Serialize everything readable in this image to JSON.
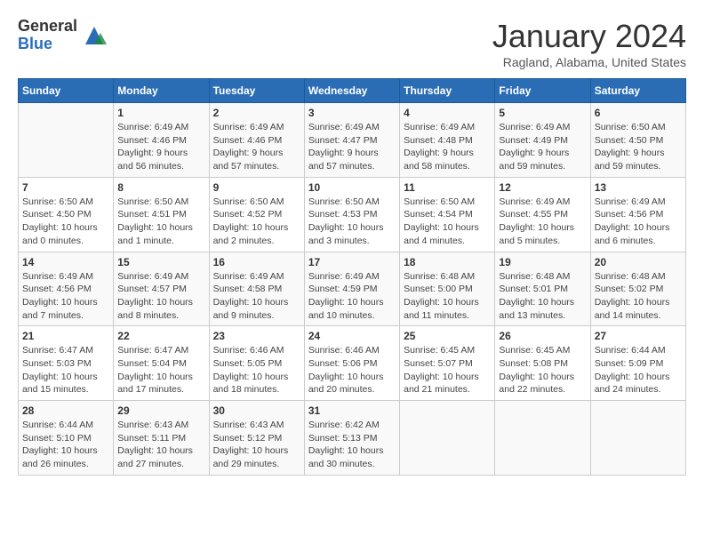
{
  "header": {
    "logo_general": "General",
    "logo_blue": "Blue",
    "month_title": "January 2024",
    "location": "Ragland, Alabama, United States"
  },
  "columns": [
    "Sunday",
    "Monday",
    "Tuesday",
    "Wednesday",
    "Thursday",
    "Friday",
    "Saturday"
  ],
  "weeks": [
    {
      "days": [
        {
          "number": "",
          "info": ""
        },
        {
          "number": "1",
          "info": "Sunrise: 6:49 AM\nSunset: 4:46 PM\nDaylight: 9 hours\nand 56 minutes."
        },
        {
          "number": "2",
          "info": "Sunrise: 6:49 AM\nSunset: 4:46 PM\nDaylight: 9 hours\nand 57 minutes."
        },
        {
          "number": "3",
          "info": "Sunrise: 6:49 AM\nSunset: 4:47 PM\nDaylight: 9 hours\nand 57 minutes."
        },
        {
          "number": "4",
          "info": "Sunrise: 6:49 AM\nSunset: 4:48 PM\nDaylight: 9 hours\nand 58 minutes."
        },
        {
          "number": "5",
          "info": "Sunrise: 6:49 AM\nSunset: 4:49 PM\nDaylight: 9 hours\nand 59 minutes."
        },
        {
          "number": "6",
          "info": "Sunrise: 6:50 AM\nSunset: 4:50 PM\nDaylight: 9 hours\nand 59 minutes."
        }
      ]
    },
    {
      "days": [
        {
          "number": "7",
          "info": "Sunrise: 6:50 AM\nSunset: 4:50 PM\nDaylight: 10 hours\nand 0 minutes."
        },
        {
          "number": "8",
          "info": "Sunrise: 6:50 AM\nSunset: 4:51 PM\nDaylight: 10 hours\nand 1 minute."
        },
        {
          "number": "9",
          "info": "Sunrise: 6:50 AM\nSunset: 4:52 PM\nDaylight: 10 hours\nand 2 minutes."
        },
        {
          "number": "10",
          "info": "Sunrise: 6:50 AM\nSunset: 4:53 PM\nDaylight: 10 hours\nand 3 minutes."
        },
        {
          "number": "11",
          "info": "Sunrise: 6:50 AM\nSunset: 4:54 PM\nDaylight: 10 hours\nand 4 minutes."
        },
        {
          "number": "12",
          "info": "Sunrise: 6:49 AM\nSunset: 4:55 PM\nDaylight: 10 hours\nand 5 minutes."
        },
        {
          "number": "13",
          "info": "Sunrise: 6:49 AM\nSunset: 4:56 PM\nDaylight: 10 hours\nand 6 minutes."
        }
      ]
    },
    {
      "days": [
        {
          "number": "14",
          "info": "Sunrise: 6:49 AM\nSunset: 4:56 PM\nDaylight: 10 hours\nand 7 minutes."
        },
        {
          "number": "15",
          "info": "Sunrise: 6:49 AM\nSunset: 4:57 PM\nDaylight: 10 hours\nand 8 minutes."
        },
        {
          "number": "16",
          "info": "Sunrise: 6:49 AM\nSunset: 4:58 PM\nDaylight: 10 hours\nand 9 minutes."
        },
        {
          "number": "17",
          "info": "Sunrise: 6:49 AM\nSunset: 4:59 PM\nDaylight: 10 hours\nand 10 minutes."
        },
        {
          "number": "18",
          "info": "Sunrise: 6:48 AM\nSunset: 5:00 PM\nDaylight: 10 hours\nand 11 minutes."
        },
        {
          "number": "19",
          "info": "Sunrise: 6:48 AM\nSunset: 5:01 PM\nDaylight: 10 hours\nand 13 minutes."
        },
        {
          "number": "20",
          "info": "Sunrise: 6:48 AM\nSunset: 5:02 PM\nDaylight: 10 hours\nand 14 minutes."
        }
      ]
    },
    {
      "days": [
        {
          "number": "21",
          "info": "Sunrise: 6:47 AM\nSunset: 5:03 PM\nDaylight: 10 hours\nand 15 minutes."
        },
        {
          "number": "22",
          "info": "Sunrise: 6:47 AM\nSunset: 5:04 PM\nDaylight: 10 hours\nand 17 minutes."
        },
        {
          "number": "23",
          "info": "Sunrise: 6:46 AM\nSunset: 5:05 PM\nDaylight: 10 hours\nand 18 minutes."
        },
        {
          "number": "24",
          "info": "Sunrise: 6:46 AM\nSunset: 5:06 PM\nDaylight: 10 hours\nand 20 minutes."
        },
        {
          "number": "25",
          "info": "Sunrise: 6:45 AM\nSunset: 5:07 PM\nDaylight: 10 hours\nand 21 minutes."
        },
        {
          "number": "26",
          "info": "Sunrise: 6:45 AM\nSunset: 5:08 PM\nDaylight: 10 hours\nand 22 minutes."
        },
        {
          "number": "27",
          "info": "Sunrise: 6:44 AM\nSunset: 5:09 PM\nDaylight: 10 hours\nand 24 minutes."
        }
      ]
    },
    {
      "days": [
        {
          "number": "28",
          "info": "Sunrise: 6:44 AM\nSunset: 5:10 PM\nDaylight: 10 hours\nand 26 minutes."
        },
        {
          "number": "29",
          "info": "Sunrise: 6:43 AM\nSunset: 5:11 PM\nDaylight: 10 hours\nand 27 minutes."
        },
        {
          "number": "30",
          "info": "Sunrise: 6:43 AM\nSunset: 5:12 PM\nDaylight: 10 hours\nand 29 minutes."
        },
        {
          "number": "31",
          "info": "Sunrise: 6:42 AM\nSunset: 5:13 PM\nDaylight: 10 hours\nand 30 minutes."
        },
        {
          "number": "",
          "info": ""
        },
        {
          "number": "",
          "info": ""
        },
        {
          "number": "",
          "info": ""
        }
      ]
    }
  ]
}
